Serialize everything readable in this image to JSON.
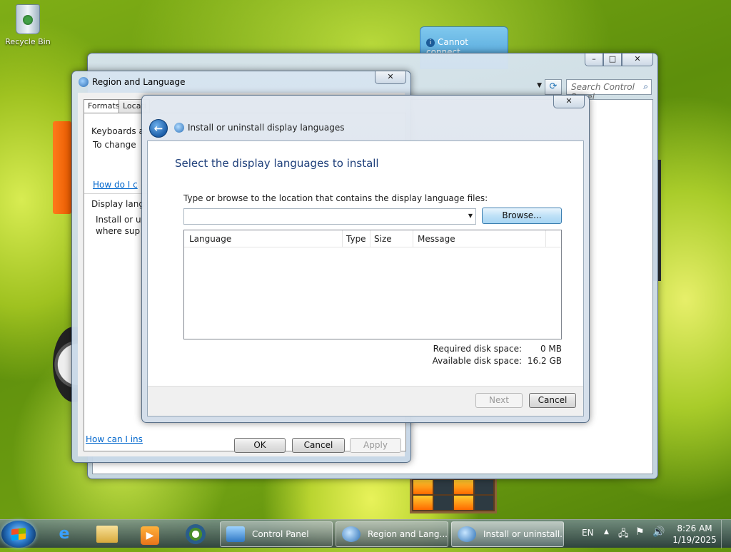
{
  "desktop": {
    "recycle_bin_label": "Recycle Bin",
    "notification_text": "Cannot connect"
  },
  "control_panel": {
    "search_placeholder": "Search Control Panel",
    "minimize": "–",
    "maximize": "□",
    "close": "✕"
  },
  "region_language": {
    "title": "Region and Language",
    "tabs": [
      "Formats",
      "Locati"
    ],
    "keyboards_heading": "Keyboards a",
    "keyboards_text": "To change",
    "keyboards_link": "How do I c",
    "display_heading": "Display lang",
    "display_text_1": "Install or u",
    "display_text_2": "where sup",
    "bottom_link": "How can I ins",
    "ok": "OK",
    "cancel": "Cancel",
    "apply": "Apply",
    "close": "✕"
  },
  "install_dialog": {
    "title": "Install or uninstall display languages",
    "heading": "Select the display languages to install",
    "prompt": "Type or browse to the location that contains the display language files:",
    "browse": "Browse...",
    "columns": [
      "Language",
      "Type",
      "Size",
      "Message"
    ],
    "required_label": "Required disk space:",
    "required_value": "0 MB",
    "available_label": "Available disk space:",
    "available_value": "16.2 GB",
    "next": "Next",
    "cancel": "Cancel",
    "close": "✕",
    "back_arrow": "←"
  },
  "taskbar": {
    "buttons": [
      "Control Panel",
      "Region and Lang...",
      "Install or uninstall..."
    ],
    "language": "EN",
    "time": "8:26 AM",
    "date": "1/19/2025"
  }
}
